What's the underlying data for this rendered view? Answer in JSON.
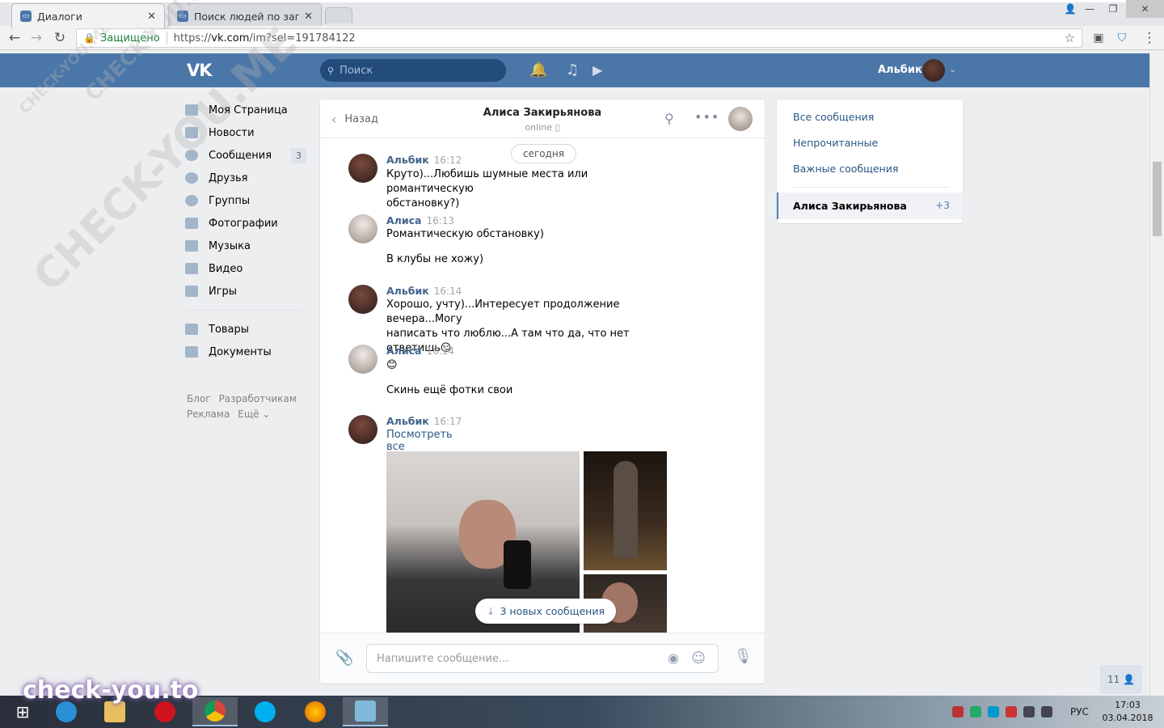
{
  "browser": {
    "tabs": [
      {
        "title": "Диалоги",
        "active": true
      },
      {
        "title": "Поиск людей по запрос",
        "active": false
      }
    ],
    "security_label": "Защищено",
    "url_prefix": "https://",
    "url_host": "vk.com",
    "url_path": "/im?sel=191784122"
  },
  "vk_header": {
    "logo": "VK",
    "search_placeholder": "Поиск",
    "username": "Альбик",
    "brand_color": "#4a76a8"
  },
  "left_nav": {
    "items": [
      {
        "label": "Моя Страница",
        "icon": "home-icon"
      },
      {
        "label": "Новости",
        "icon": "news-icon"
      },
      {
        "label": "Сообщения",
        "icon": "messages-icon",
        "count": "3"
      },
      {
        "label": "Друзья",
        "icon": "friends-icon"
      },
      {
        "label": "Группы",
        "icon": "groups-icon"
      },
      {
        "label": "Фотографии",
        "icon": "camera-icon"
      },
      {
        "label": "Музыка",
        "icon": "music-icon"
      },
      {
        "label": "Видео",
        "icon": "video-icon"
      },
      {
        "label": "Игры",
        "icon": "games-icon"
      }
    ],
    "items2": [
      {
        "label": "Товары",
        "icon": "market-icon"
      },
      {
        "label": "Документы",
        "icon": "documents-icon"
      }
    ],
    "footer": {
      "blog": "Блог",
      "dev": "Разработчикам",
      "ads": "Реклама",
      "more": "Ещё ⌄"
    }
  },
  "dialog": {
    "back_label": "Назад",
    "contact_name": "Алиса Закирьянова",
    "status": "online",
    "date_divider": "сегодня",
    "messages": [
      {
        "author": "Альбик",
        "time": "16:12",
        "lines": [
          "Круто)...Любишь шумные места или романтическую",
          "обстановку?)"
        ]
      },
      {
        "author": "Алиса",
        "time": "16:13",
        "lines": [
          "Романтическую обстановку)"
        ],
        "extra": "В клубы не хожу)"
      },
      {
        "author": "Альбик",
        "time": "16:14",
        "lines": [
          "Хорошо, учту)...Интересует продолжение вечера...Могу",
          "написать что люблю...А там что да, что нет ответишь😏"
        ]
      },
      {
        "author": "Алиса",
        "time": "16:14",
        "lines": [
          "😊"
        ],
        "extra": "Скинь ещё фотки свои"
      },
      {
        "author": "Альбик",
        "time": "16:17",
        "link": "Посмотреть все изображения"
      }
    ],
    "new_messages_label": "3 новых сообщения",
    "composer_placeholder": "Напишите сообщение..."
  },
  "right_panel": {
    "items": [
      "Все сообщения",
      "Непрочитанные",
      "Важные сообщения"
    ],
    "selected": {
      "name": "Алиса Закирьянова",
      "count": "+3"
    }
  },
  "online_badge": "11",
  "watermark": {
    "text": "CHECK-YOU.ME",
    "brand": "check-you.to"
  },
  "taskbar": {
    "lang": "РУС",
    "time": "17:03",
    "date": "03.04.2018"
  }
}
